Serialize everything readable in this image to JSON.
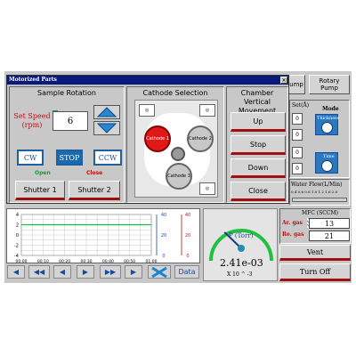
{
  "window": {
    "title": "Motorized Parts"
  },
  "top_right": {
    "pump_label": "ump",
    "rotary_pump_label": "Rotary Pump"
  },
  "sample_rotation": {
    "title": "Sample Rotation",
    "set_speed_label": "Set Speed (rpm)",
    "speed_value": "6",
    "cw_label": "CW",
    "stop_label": "STOP",
    "ccw_label": "CCW",
    "open_label": "Open",
    "close_label": "Close",
    "shutter1_label": "Shutter 1",
    "shutter2_label": "Shutter 2"
  },
  "cathode_selection": {
    "title": "Cathode Selection",
    "cathodes": [
      "Cathode 1",
      "Cathode 2",
      "Cathode 3"
    ],
    "active_cathode": "Cathode 1"
  },
  "chamber_vertical": {
    "title": "Chamber Vertical Movement",
    "up_label": "Up",
    "stop_label": "Stop",
    "down_label": "Down",
    "close_label": "Close"
  },
  "right_panel": {
    "set_label": "Set(Å)",
    "mode_label": "Mode",
    "thickness_label": "Thickness",
    "time_label": "Time",
    "water_flow_label": "Water Flow(L/Min)",
    "water_scale": "0.4 0.6 0.8 1.0 1.2 1.6 2.0",
    "values": [
      "0",
      "0",
      "0",
      "0"
    ]
  },
  "chart": {
    "y_left_ticks": [
      "4",
      "2",
      "0",
      "-2",
      "-4"
    ],
    "y_mid_ticks": [
      "40",
      "20",
      "0"
    ],
    "y_right_ticks": [
      "40",
      "20",
      "0"
    ],
    "x_ticks": [
      "00:00",
      "00:10",
      "00:20",
      "00:30",
      "00:40",
      "00:50",
      "01:00"
    ]
  },
  "chart_data": {
    "type": "line",
    "x": [
      "00:00",
      "00:10",
      "00:20",
      "00:30",
      "00:40",
      "00:50",
      "01:00"
    ],
    "series": [
      {
        "values": [
          2,
          2,
          2,
          2,
          2,
          2,
          2
        ]
      }
    ],
    "ylim": [
      -4,
      4
    ],
    "grid": true
  },
  "gauge": {
    "label": "P (Torr)",
    "value": "2.41e-03",
    "unit": "X 10 ^ -3",
    "level": 0.33
  },
  "mfc": {
    "title": "MFC (SCCM)",
    "ar_label": "Ar. gas",
    "ar_value": "13",
    "re_label": "Re. gas",
    "re_value": "21",
    "vent_label": "Vent",
    "turnoff_label": "Turn Off"
  },
  "nav": {
    "data_label": "Data"
  },
  "colors": {
    "accent": "#1a6ab0",
    "alert": "#c01010",
    "series": "#10c040",
    "titlebar": "#0a1a7a"
  }
}
